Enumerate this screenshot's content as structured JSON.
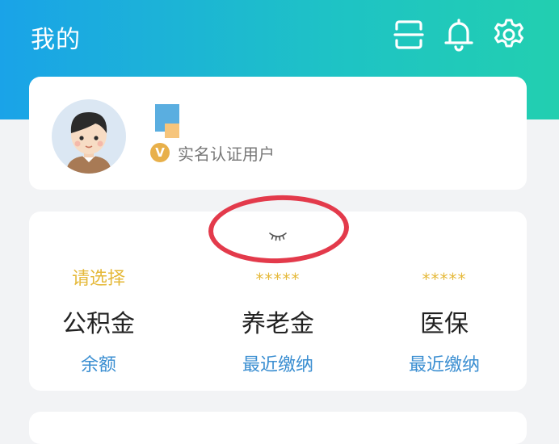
{
  "header": {
    "title": "我的",
    "icons": [
      "scan-icon",
      "bell-icon",
      "gear-icon"
    ],
    "gradient_start": "#1aa3e8",
    "gradient_end": "#22cfb0"
  },
  "profile": {
    "verification_badge": "V",
    "verification_text": "实名认证用户"
  },
  "funds": {
    "items": [
      {
        "status": "请选择",
        "name": "公积金",
        "action": "余额"
      },
      {
        "status": "*****",
        "name": "养老金",
        "action": "最近缴纳"
      },
      {
        "status": "*****",
        "name": "医保",
        "action": "最近缴纳"
      }
    ],
    "toggle_icon": "eye-closed-icon",
    "annotation_color": "#e33a4b"
  },
  "colors": {
    "status_yellow": "#e5b93a",
    "link_blue": "#3a8ed1",
    "background": "#f2f3f5"
  }
}
